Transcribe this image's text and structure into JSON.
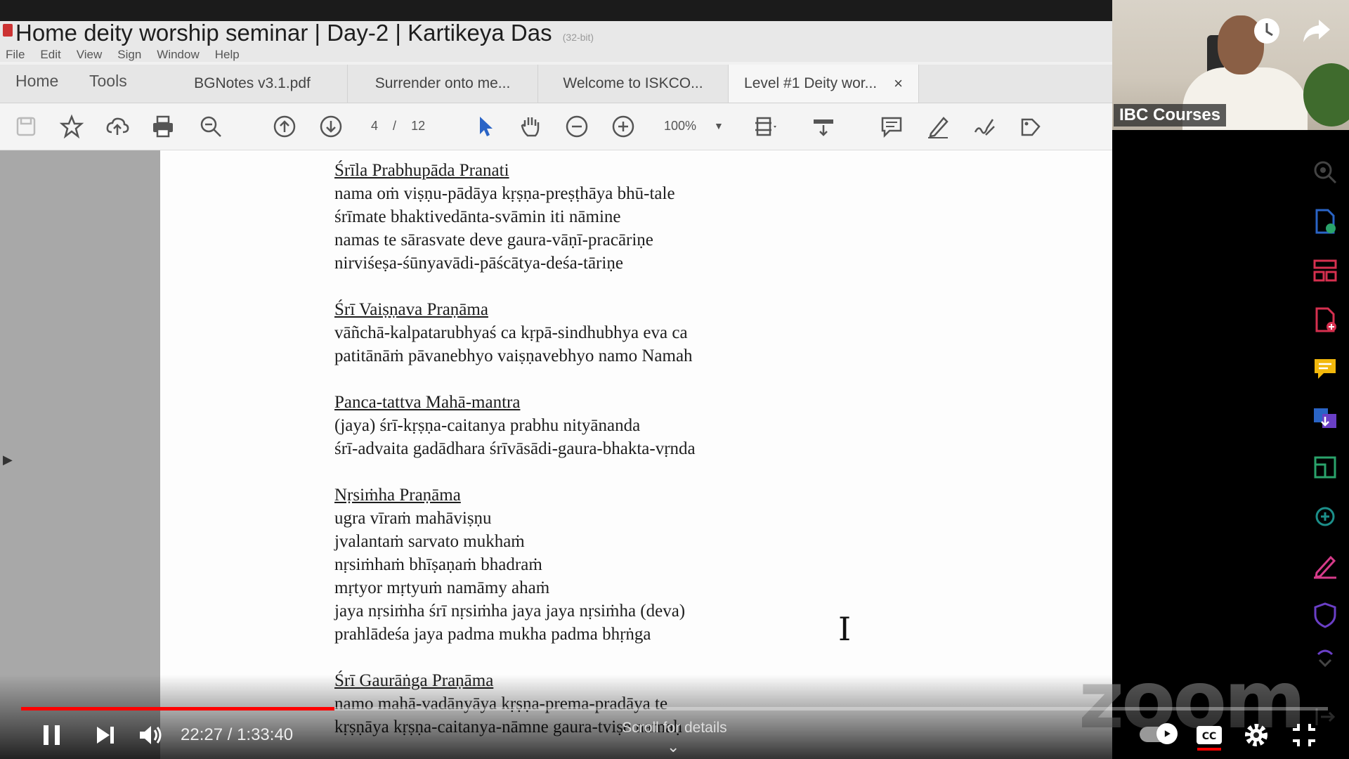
{
  "window": {
    "title": "Home deity worship seminar | Day-2 | Kartikeya Das",
    "title_suffix": "(32-bit)",
    "menu": [
      "File",
      "Edit",
      "View",
      "Sign",
      "Window",
      "Help"
    ]
  },
  "nav": {
    "home": "Home",
    "tools": "Tools"
  },
  "tabs": [
    {
      "label": "BGNotes v3.1.pdf"
    },
    {
      "label": "Surrender onto me..."
    },
    {
      "label": "Welcome to  ISKCO..."
    },
    {
      "label": "Level #1 Deity wor...",
      "close": "×"
    }
  ],
  "toolbar": {
    "current_page": "4",
    "page_separator": "/",
    "total_pages": "12",
    "zoom": "100%"
  },
  "document": {
    "sections": [
      {
        "heading": "Śrīla Prabhupāda Pranati",
        "lines": [
          "nama oṁ viṣṇu-pādāya kṛṣṇa-preṣṭhāya bhū-tale",
          "śrīmate bhaktivedānta-svāmin iti nāmine",
          "namas te sārasvate deve gaura-vāṇī-pracāriṇe",
          "nirviśeṣa-śūnyavādi-pāścātya-deśa-tāriṇe"
        ]
      },
      {
        "heading": "Śrī Vaiṣṇava Praṇāma",
        "lines": [
          "vāñchā-kalpatarubhyaś ca kṛpā-sindhubhya eva ca",
          "patitānāṁ pāvanebhyo vaiṣṇavebhyo namo Namah"
        ]
      },
      {
        "heading": "Panca-tattva Mahā-mantra",
        "lines": [
          "(jaya) śrī-kṛṣṇa-caitanya prabhu nityānanda",
          "śrī-advaita gadādhara śrīvāsādi-gaura-bhakta-vṛnda"
        ]
      },
      {
        "heading": "Nṛsiṁha Praṇāma",
        "lines": [
          "ugra vīraṁ mahāviṣṇu",
          "jvalantaṁ sarvato mukhaṁ",
          "nṛsiṁhaṁ bhīṣaṇaṁ bhadraṁ",
          "mṛtyor mṛtyuṁ namāmy ahaṁ",
          "jaya nṛsiṁha śrī nṛsiṁha jaya jaya nṛsiṁha (deva)",
          "prahlādeśa jaya padma mukha padma bhṛṅga"
        ]
      },
      {
        "heading": "Śrī Gaurāṅga Praṇāma",
        "lines": [
          "namo mahā-vadānyāya kṛṣṇa-prema-pradāya te",
          "kṛṣṇāya kṛṣṇa-caitanya-nāmne gaura-tviṣe namaḥ"
        ]
      }
    ]
  },
  "webcam": {
    "label": "IBC Courses"
  },
  "watermark": {
    "text": "zoom"
  },
  "player": {
    "time": "22:27 / 1:33:40",
    "progress_fraction": 0.2396,
    "scroll_hint": "Scroll for details",
    "accent": "#ff0000"
  }
}
